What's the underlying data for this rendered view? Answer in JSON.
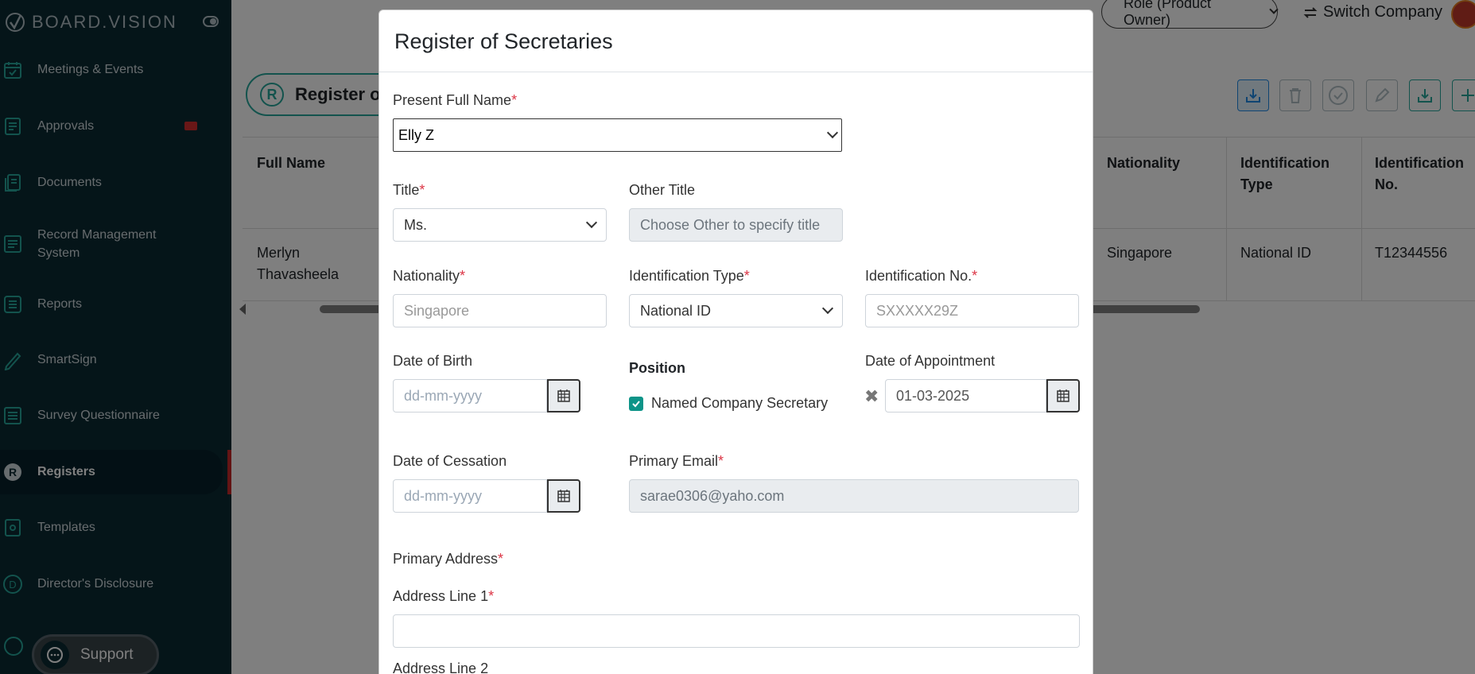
{
  "sidebar": {
    "logo_text": "BOARD.VISION",
    "items": [
      {
        "label": "Meetings & Events",
        "icon": "calendar-icon"
      },
      {
        "label": "Approvals",
        "icon": "approvals-icon"
      },
      {
        "label": "Documents",
        "icon": "documents-icon"
      },
      {
        "label": "Record Management System",
        "icon": "records-icon"
      },
      {
        "label": "Reports",
        "icon": "reports-icon"
      },
      {
        "label": "SmartSign",
        "icon": "pen-icon"
      },
      {
        "label": "Survey Questionnaire",
        "icon": "survey-icon"
      },
      {
        "label": "Registers",
        "icon": "registers-icon"
      },
      {
        "label": "Templates",
        "icon": "templates-icon"
      },
      {
        "label": "Director's Disclosure",
        "icon": "disclosure-icon"
      }
    ],
    "support_label": "Support"
  },
  "header": {
    "role_label": "Role (Product Owner)",
    "switch_company_label": "Switch Company"
  },
  "page": {
    "title": "Register o",
    "table": {
      "headers": {
        "full_name": "Full Name",
        "nationality": "Nationality",
        "id_type": "Identification Type",
        "id_no": "Identification No."
      },
      "row": {
        "full_name": "Merlyn Thavasheela",
        "nationality": "Singapore",
        "id_type": "National ID",
        "id_no": "T12344556"
      }
    }
  },
  "modal": {
    "title": "Register of Secretaries",
    "present_full_name_label": "Present Full Name",
    "present_full_name_value": "Elly Z",
    "title_label": "Title",
    "title_value": "Ms.",
    "other_title_label": "Other Title",
    "other_title_placeholder": "Choose Other to specify title",
    "nationality_label": "Nationality",
    "nationality_placeholder": "Singapore",
    "id_type_label": "Identification Type",
    "id_type_value": "National ID",
    "id_no_label": "Identification No.",
    "id_no_placeholder": "SXXXXX29Z",
    "dob_label": "Date of Birth",
    "date_placeholder": "dd-mm-yyyy",
    "position_label": "Position",
    "named_secretary_label": "Named Company Secretary",
    "doa_label": "Date of Appointment",
    "doa_value": "01-03-2025",
    "doc_label": "Date of Cessation",
    "primary_email_label": "Primary Email",
    "primary_email_value": "sarae0306@yaho.com",
    "primary_address_label": "Primary Address",
    "address1_label": "Address Line 1",
    "address2_label": "Address Line 2",
    "required_mark": "*"
  }
}
